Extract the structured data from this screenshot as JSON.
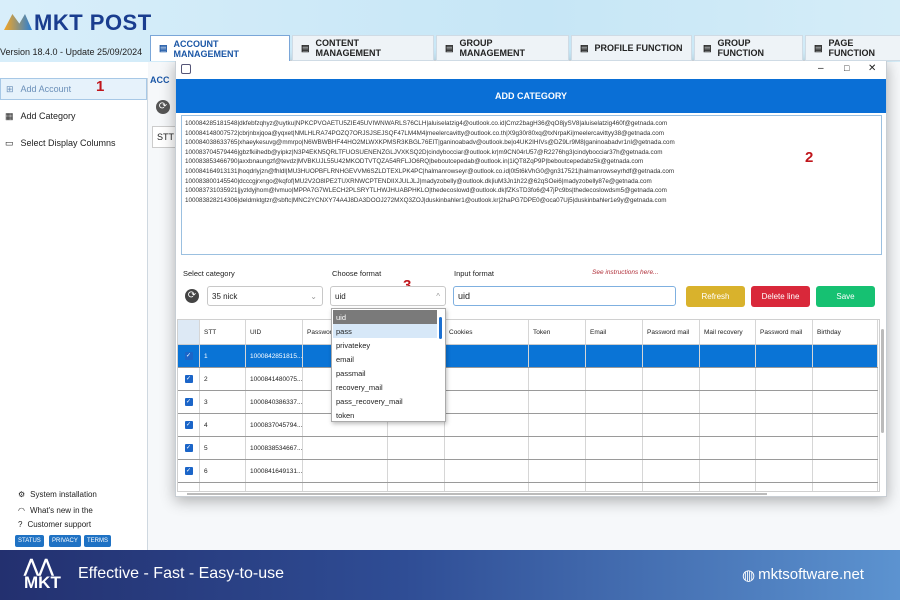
{
  "app": {
    "name": "MKT POST",
    "version": "Version  18.4.0  - Update  25/09/2024"
  },
  "tabs": [
    {
      "label": "ACCOUNT MANAGEMENT",
      "icon": "account-icon",
      "active": true
    },
    {
      "label": "CONTENT MANAGEMENT",
      "icon": "list-icon"
    },
    {
      "label": "GROUP MANAGEMENT",
      "icon": "document-icon"
    },
    {
      "label": "PROFILE FUNCTION",
      "icon": "profile-icon"
    },
    {
      "label": "GROUP FUNCTION",
      "icon": "group-icon"
    },
    {
      "label": "PAGE FUNCTION",
      "icon": "facebook-icon"
    }
  ],
  "sidebar": {
    "items": [
      {
        "label": "Add Account",
        "active": true
      },
      {
        "label": "Add Category"
      },
      {
        "label": "Select Display Columns"
      }
    ],
    "bottom": [
      {
        "label": "System installation"
      },
      {
        "label": "What's new in the"
      },
      {
        "label": "Customer support"
      }
    ],
    "pills": [
      "STATUS",
      "PRIVACY",
      "TERMS"
    ]
  },
  "main": {
    "section_label": "ACC",
    "stt_label": "STT"
  },
  "annotations": [
    "1",
    "2",
    "3"
  ],
  "dialog": {
    "title": "ADD CATEGORY",
    "textarea_lines": [
      "100084285181548|dkfebfzqhyz@uytku|NPKCPVOAETU5ZIE45UVIWNWARLS76CLH|aluiselatzig4@outlook.co.id|Cmz2bagH36@qO8jySV8|aluiselatzig460f@getnada.com",
      "100084148007572|cbrjnbxjqoa@yqxet|NMLHLRA74POZQ7ORJSJSEJSQF47LM4M4|meelercavitty@outlook.co.th|X9g30r80xq@txNrpaKi|meelercavittyy38@getnada.com",
      "100084038633765|xhaeykesuvg@mmrpo|N6WBWBHF44HO2MLWXKPMSR3KBGL76EIT|ganinoabadv@outlook.be|o4UK2IHIVs@DZ9Lr9M8|ganinoabadvr1nl@getnada.com",
      "100083704579446|gbzfkiihedb@yipkz|N3P4EKN5QRLTFUOSUENENZGLJVXKSQ2D|cindybocciar@outlook.kr|m9CN04rU57@R2276hg3|cindybocciar37h@getnada.com",
      "100083853466790|axxbnaungzf@tevdz|MVBKUJL55U42MKODTVTQZA54RFLJO6RQ|beboutcepedab@outlook.in|1iQT8ZqP9P|beboutcepedabz5k@getnada.com",
      "100084164913131|hoqdrlyjzn@fhldl|MU3HUOPBFLRNHGEVVM6SZLDTEXLPK4PC|halmanrowseyr@outlook.co.id|0t5t6kVhG0@gn317521|halmanrowseyrhdf@getnada.com",
      "100083800145540|dcccgjrxngo@kqfof|MU2V2O8IPE2TUXRNWCPTENDIIXJULJLJ|madyzobelly@outlook.dk|iuM3Jn1h22@62qSOei6|madyzobelly87e@getnada.com",
      "100083731035921|jyzldyjhom@lvmuo|MPPA7G7WLECH2PLSRYTLHWJHUABPHKLO|thedecoslowd@outlook.dk|fZKsTD3fo6@47jPc9bs|thedecoslowdsm5@getnada.com",
      "100083828214306|deldmktgtzr@sbftc|MNC2YCNXY74A4J8DA3DOOJ272MXQ3ZOJ|duskinbahler1@outlook.kr|2haPG7DPE0@oca07Uj5|duskinbahler1e9y@getnada.com"
    ],
    "select_category": {
      "label": "Select category",
      "value": "35 nick"
    },
    "choose_format": {
      "label": "Choose format",
      "value": "uid",
      "options": [
        "uid",
        "pass",
        "privatekey",
        "email",
        "passmail",
        "recovery_mail",
        "pass_recovery_mail",
        "token"
      ],
      "highlighted": "uid",
      "hovered": "pass"
    },
    "input_format": {
      "label": "Input format",
      "value": "uid",
      "instructions": "See instructions here..."
    },
    "buttons": {
      "refresh": "Refresh",
      "delete": "Delete line",
      "save": "Save"
    },
    "colors": {
      "refresh": "#d9b22c",
      "delete": "#d9283a",
      "save": "#16c172",
      "header": "#0a6fd6",
      "selected_row": "#0a74d6"
    },
    "table": {
      "columns": [
        "",
        "STT",
        "UID",
        "Password",
        "",
        "Cookies",
        "Token",
        "Email",
        "Password mail",
        "Mail recovery",
        "Password mail",
        "Birthday"
      ],
      "rows": [
        {
          "stt": "1",
          "uid": "1000842851815...",
          "checked": true,
          "selected": true
        },
        {
          "stt": "2",
          "uid": "1000841480075...",
          "checked": true
        },
        {
          "stt": "3",
          "uid": "1000840386337...",
          "checked": true
        },
        {
          "stt": "4",
          "uid": "1000837045794...",
          "checked": true
        },
        {
          "stt": "5",
          "uid": "1000838534667...",
          "checked": true
        },
        {
          "stt": "6",
          "uid": "1000841649131...",
          "checked": true
        }
      ]
    }
  },
  "footer": {
    "logo": "MKT",
    "slogan": "Effective - Fast - Easy-to-use",
    "website": "mktsoftware.net"
  }
}
